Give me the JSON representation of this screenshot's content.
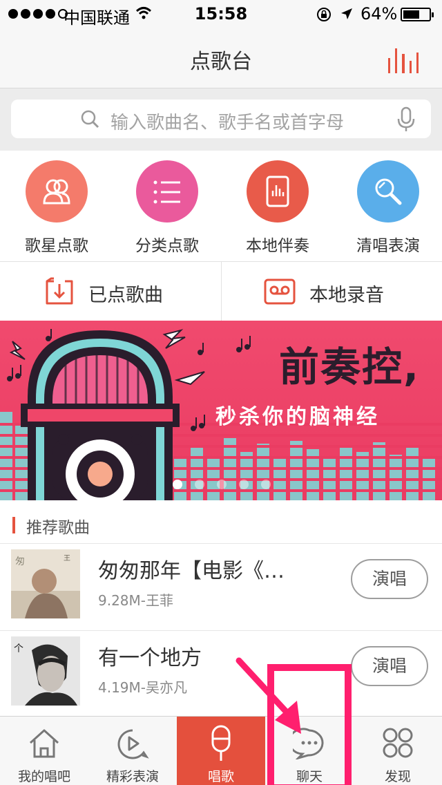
{
  "status_bar": {
    "carrier": "中国联通",
    "time": "15:58",
    "battery_percent": "64%",
    "battery_level": 0.64,
    "icons": [
      "signal-dots-icon",
      "wifi-icon",
      "rotation-lock-icon",
      "location-arrow-icon",
      "battery-icon"
    ]
  },
  "nav": {
    "title": "点歌台",
    "right_icon": "equalizer-icon"
  },
  "search": {
    "placeholder": "输入歌曲名、歌手名或首字母",
    "left_icon": "search-icon",
    "right_icon": "microphone-icon"
  },
  "quick_entries": [
    {
      "label": "歌星点歌",
      "icon": "singer-icon",
      "color": "#f47b6b"
    },
    {
      "label": "分类点歌",
      "icon": "list-icon",
      "color": "#ea5a9c"
    },
    {
      "label": "本地伴奏",
      "icon": "local-music-icon",
      "color": "#e85b4a"
    },
    {
      "label": "清唱表演",
      "icon": "handheld-mic-icon",
      "color": "#5aaeea"
    }
  ],
  "sub_entries": [
    {
      "label": "已点歌曲",
      "icon": "download-tray-icon"
    },
    {
      "label": "本地录音",
      "icon": "cassette-tape-icon"
    }
  ],
  "banner": {
    "headline": "前奏控,",
    "subline": "秒杀你的脑神经",
    "page_count": 5,
    "active_page": 0
  },
  "recommend": {
    "section_title": "推荐歌曲",
    "songs": [
      {
        "name": "匆匆那年【电影《…",
        "meta": "9.28M-王菲",
        "button": "演唱"
      },
      {
        "name": "有一个地方",
        "meta": "4.19M-吴亦凡",
        "button": "演唱"
      }
    ]
  },
  "tabbar": {
    "tabs": [
      {
        "label": "我的唱吧",
        "icon": "home-icon"
      },
      {
        "label": "精彩表演",
        "icon": "play-bubble-icon"
      },
      {
        "label": "唱歌",
        "icon": "microphone-icon"
      },
      {
        "label": "聊天",
        "icon": "chat-bubble-icon"
      },
      {
        "label": "发现",
        "icon": "discover-circles-icon"
      }
    ],
    "active_index": 2
  },
  "colors": {
    "accent": "#e4503d",
    "banner_bg": "#ef4669",
    "annotation": "#ff1f6e"
  }
}
